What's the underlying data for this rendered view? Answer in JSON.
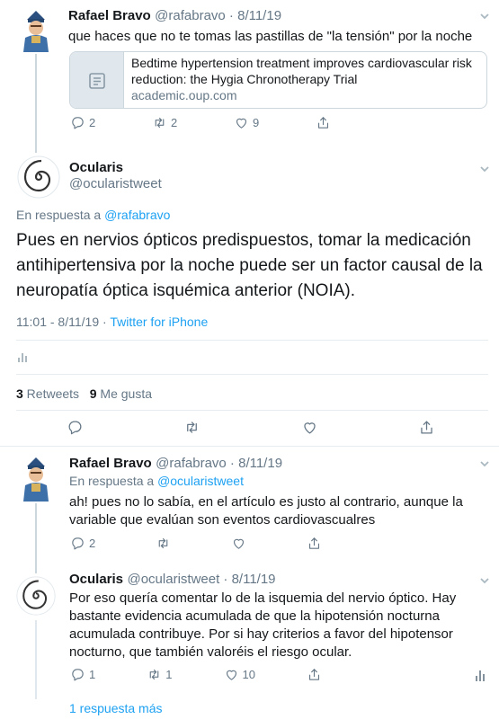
{
  "tweet1": {
    "name": "Rafael Bravo",
    "handle_date": "@rafabravo · 8/11/19",
    "text": "que haces que no te tomas las pastillas de \"la tensión\" por la noche",
    "card": {
      "title": "Bedtime hypertension treatment improves cardiovascular risk reduction: the Hygia Chronotherapy Trial",
      "domain": "academic.oup.com"
    },
    "replies": "2",
    "retweets": "2",
    "likes": "9"
  },
  "main_tweet": {
    "name": "Ocularis",
    "handle": "@ocularistweet",
    "reply_prefix": "En respuesta a ",
    "reply_to": "@rafabravo",
    "text": "Pues en nervios ópticos predispuestos, tomar la medicación antihipertensiva por la noche puede ser un factor causal de la neuropatía óptica isquémica anterior (NOIA).",
    "time": "11:01 - 8/11/19",
    "separator": " · ",
    "source": "Twitter for iPhone",
    "retweets_count": "3",
    "retweets_label": " Retweets",
    "likes_count": "9",
    "likes_label": " Me gusta"
  },
  "tweet3": {
    "name": "Rafael Bravo",
    "handle_date": "@rafabravo · 8/11/19",
    "reply_prefix": "En respuesta a ",
    "reply_to": "@ocularistweet",
    "text": "ah! pues no lo sabía, en el artículo es justo al contrario, aunque la variable que evalúan son eventos cardiovascualres",
    "replies": "2"
  },
  "tweet4": {
    "name": "Ocularis",
    "handle_date": "@ocularistweet · 8/11/19",
    "text": "Por eso quería comentar lo de la isquemia del nervio óptico. Hay bastante evidencia acumulada de que la hipotensión nocturna acumulada contribuye. Por si hay criterios a favor del hipotensor nocturno, que también valoréis el riesgo ocular.",
    "replies": "1",
    "retweets": "1",
    "likes": "10"
  },
  "more_replies": "1 respuesta más",
  "colors": {
    "accent": "#1da1f2",
    "secondary_text": "#657786",
    "divider": "#e6ecf0"
  }
}
